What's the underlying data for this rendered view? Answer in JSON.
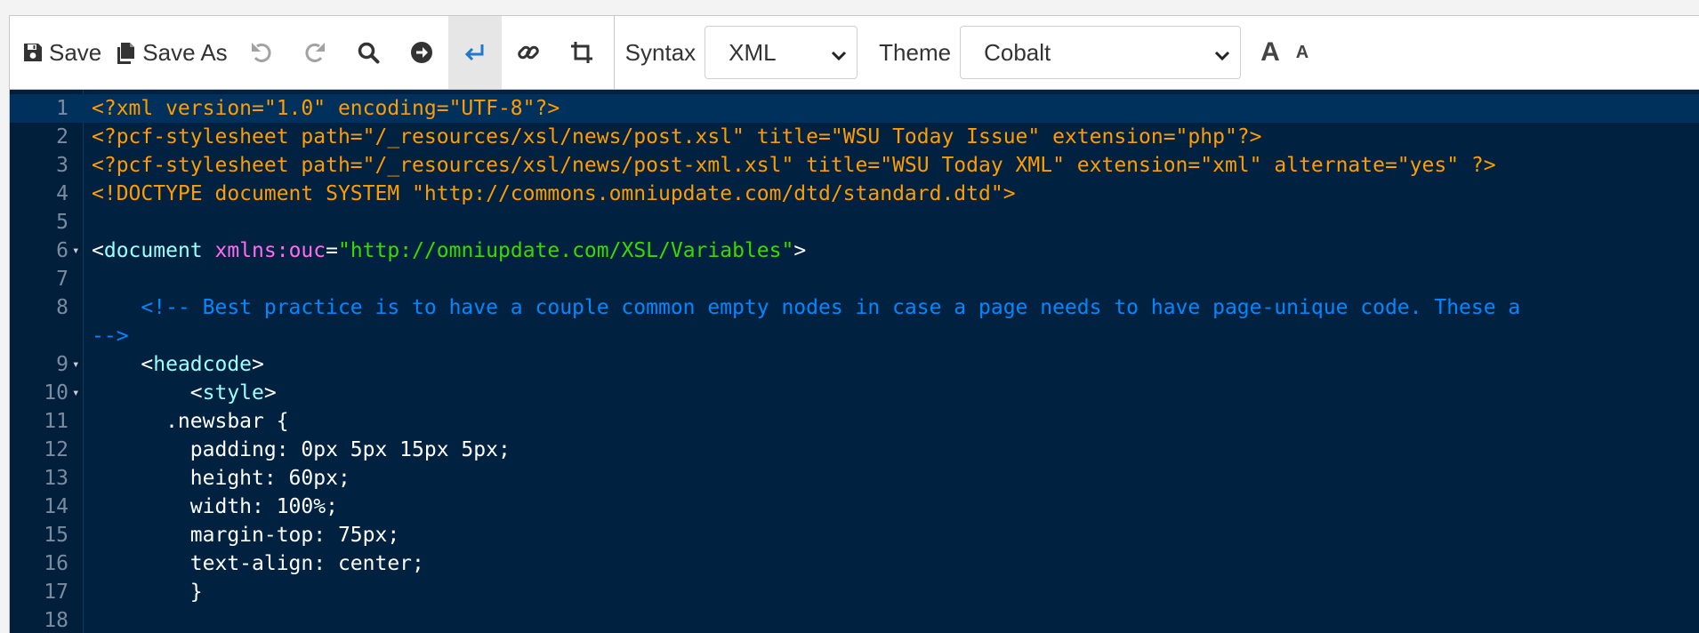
{
  "toolbar": {
    "save_label": "Save",
    "save_as_label": "Save As",
    "syntax_label": "Syntax",
    "syntax_value": "XML",
    "theme_label": "Theme",
    "theme_value": "Cobalt",
    "font_increase_label": "A",
    "font_decrease_label": "A"
  },
  "colors": {
    "editor_bg": "#002240",
    "processing_instruction": "#ff9d00",
    "tag": "#9effff",
    "attribute": "#ff6cf0",
    "string": "#3ad900",
    "comment": "#0088ff",
    "active_line": "#00315c"
  },
  "editor": {
    "lines": [
      {
        "num": "1",
        "fold": "",
        "current": true,
        "segments": [
          {
            "c": "pi",
            "t": "<?xml version=\"1.0\" encoding=\"UTF-8\"?>"
          }
        ]
      },
      {
        "num": "2",
        "fold": "",
        "segments": [
          {
            "c": "pi",
            "t": "<?pcf-stylesheet path=\"/_resources/xsl/news/post.xsl\" title=\"WSU Today Issue\" extension=\"php\"?>"
          }
        ]
      },
      {
        "num": "3",
        "fold": "",
        "segments": [
          {
            "c": "pi",
            "t": "<?pcf-stylesheet path=\"/_resources/xsl/news/post-xml.xsl\" title=\"WSU Today XML\" extension=\"xml\" alternate=\"yes\" ?>"
          }
        ]
      },
      {
        "num": "4",
        "fold": "",
        "segments": [
          {
            "c": "pi",
            "t": "<!DOCTYPE document SYSTEM \"http://commons.omniupdate.com/dtd/standard.dtd\">"
          }
        ]
      },
      {
        "num": "5",
        "fold": "",
        "segments": []
      },
      {
        "num": "6",
        "fold": "▾",
        "segments": [
          {
            "c": "plain",
            "t": "<"
          },
          {
            "c": "tag",
            "t": "document"
          },
          {
            "c": "plain",
            "t": " "
          },
          {
            "c": "attr",
            "t": "xmlns:ouc"
          },
          {
            "c": "plain",
            "t": "="
          },
          {
            "c": "str",
            "t": "\"http://omniupdate.com/XSL/Variables\""
          },
          {
            "c": "plain",
            "t": ">"
          }
        ]
      },
      {
        "num": "7",
        "fold": "",
        "segments": []
      },
      {
        "num": "8",
        "fold": "",
        "segments": [
          {
            "c": "cmt",
            "t": "    <!-- Best practice is to have a couple common empty nodes in case a page needs to have page-unique code. These a"
          }
        ]
      },
      {
        "num": "",
        "fold": "",
        "segments": [
          {
            "c": "cmt",
            "t": "-->"
          }
        ]
      },
      {
        "num": "9",
        "fold": "▾",
        "segments": [
          {
            "c": "plain",
            "t": "    <"
          },
          {
            "c": "tag",
            "t": "headcode"
          },
          {
            "c": "plain",
            "t": ">"
          }
        ]
      },
      {
        "num": "10",
        "fold": "▾",
        "segments": [
          {
            "c": "plain",
            "t": "        <"
          },
          {
            "c": "tag",
            "t": "style"
          },
          {
            "c": "plain",
            "t": ">"
          }
        ]
      },
      {
        "num": "11",
        "fold": "",
        "segments": [
          {
            "c": "plain",
            "t": "      .newsbar {"
          }
        ]
      },
      {
        "num": "12",
        "fold": "",
        "segments": [
          {
            "c": "plain",
            "t": "        padding: 0px 5px 15px 5px;"
          }
        ]
      },
      {
        "num": "13",
        "fold": "",
        "segments": [
          {
            "c": "plain",
            "t": "        height: 60px;"
          }
        ]
      },
      {
        "num": "14",
        "fold": "",
        "segments": [
          {
            "c": "plain",
            "t": "        width: 100%;"
          }
        ]
      },
      {
        "num": "15",
        "fold": "",
        "segments": [
          {
            "c": "plain",
            "t": "        margin-top: 75px;"
          }
        ]
      },
      {
        "num": "16",
        "fold": "",
        "segments": [
          {
            "c": "plain",
            "t": "        text-align: center;"
          }
        ]
      },
      {
        "num": "17",
        "fold": "",
        "segments": [
          {
            "c": "plain",
            "t": "        }"
          }
        ]
      },
      {
        "num": "18",
        "fold": "",
        "segments": []
      }
    ]
  }
}
